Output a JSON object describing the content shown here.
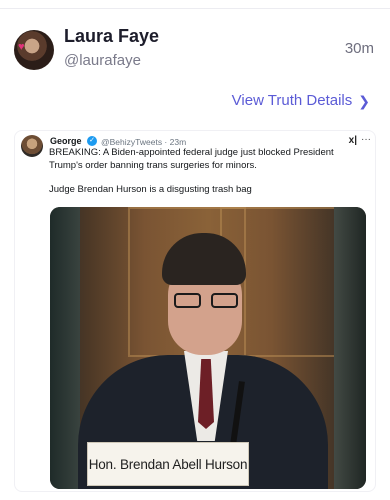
{
  "author": {
    "name": "Laura Faye",
    "handle": "@laurafaye",
    "time": "30m"
  },
  "details_link": {
    "label": "View Truth Details",
    "icon": "chevron-right-icon"
  },
  "embedded_tweet": {
    "name": "George",
    "verified": true,
    "handle_time": "@BehizyTweets · 23m",
    "brand_icon": "x-grok-icon",
    "brand_label": "x|",
    "more_label": "···",
    "text_line1": "BREAKING: A Biden-appointed federal judge just blocked President",
    "text_line2": "Trump's order banning trans surgeries for minors.",
    "text_line3": "Judge Brendan Hurson is a disgusting trash bag",
    "photo_caption": "Hon. Brendan Abell Hurson"
  },
  "colors": {
    "accent": "#5b5bd6",
    "verified": "#1d9bf0"
  }
}
